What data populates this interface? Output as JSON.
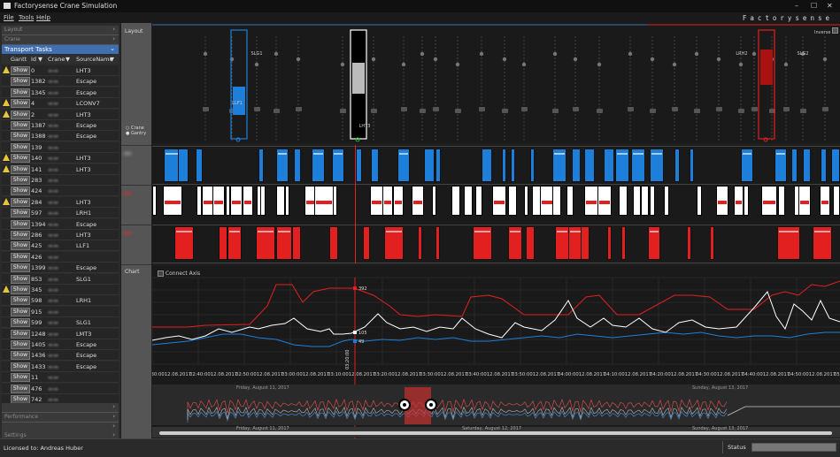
{
  "window": {
    "title": "Factorysense Crane Simulation",
    "brand": "Factorysense"
  },
  "menu": [
    "File",
    "Tools",
    "Help"
  ],
  "left_panel": {
    "collapsed_top": [
      "Layout",
      "Crane"
    ],
    "transport_tasks_label": "Transport Tasks",
    "columns": [
      "Gantt",
      "Id",
      "Crane",
      "SourceName"
    ],
    "show_label": "Show",
    "rows": [
      {
        "warn": true,
        "id": "0",
        "src": "LHT3"
      },
      {
        "warn": false,
        "id": "1382",
        "src": "Escape"
      },
      {
        "warn": false,
        "id": "1345",
        "src": "Escape"
      },
      {
        "warn": true,
        "id": "4",
        "src": "LCONV7"
      },
      {
        "warn": true,
        "id": "2",
        "src": "LHT3"
      },
      {
        "warn": false,
        "id": "1387",
        "src": "Escape"
      },
      {
        "warn": false,
        "id": "1388",
        "src": "Escape"
      },
      {
        "warn": false,
        "id": "139",
        "src": ""
      },
      {
        "warn": true,
        "id": "140",
        "src": "LHT3"
      },
      {
        "warn": true,
        "id": "141",
        "src": "LHT3"
      },
      {
        "warn": false,
        "id": "283",
        "src": ""
      },
      {
        "warn": false,
        "id": "424",
        "src": ""
      },
      {
        "warn": true,
        "id": "284",
        "src": "LHT3"
      },
      {
        "warn": false,
        "id": "597",
        "src": "LRH1"
      },
      {
        "warn": false,
        "id": "1394",
        "src": "Escape"
      },
      {
        "warn": false,
        "id": "286",
        "src": "LHT3"
      },
      {
        "warn": false,
        "id": "425",
        "src": "LLF1"
      },
      {
        "warn": false,
        "id": "426",
        "src": ""
      },
      {
        "warn": false,
        "id": "1399",
        "src": "Escape"
      },
      {
        "warn": false,
        "id": "853",
        "src": "SLG1"
      },
      {
        "warn": true,
        "id": "345",
        "src": ""
      },
      {
        "warn": false,
        "id": "598",
        "src": "LRH1"
      },
      {
        "warn": false,
        "id": "915",
        "src": ""
      },
      {
        "warn": false,
        "id": "599",
        "src": "SLG1"
      },
      {
        "warn": false,
        "id": "1248",
        "src": "LMT3"
      },
      {
        "warn": false,
        "id": "1405",
        "src": "Escape"
      },
      {
        "warn": false,
        "id": "1436",
        "src": "Escape"
      },
      {
        "warn": false,
        "id": "1433",
        "src": "Escape"
      },
      {
        "warn": false,
        "id": "11",
        "src": ""
      },
      {
        "warn": false,
        "id": "476",
        "src": ""
      },
      {
        "warn": false,
        "id": "742",
        "src": ""
      }
    ],
    "collapsed_bottom": [
      "",
      "Performance",
      "",
      "Settings"
    ]
  },
  "sidebar": {
    "layout": "Layout",
    "chart": "Chart"
  },
  "layout": {
    "legend": [
      "Crane",
      "Gantry"
    ],
    "inverse_label": "Inverse",
    "labels": [
      "SLG1",
      "LHT3",
      "LLF1",
      "LRH2",
      "SLG2"
    ]
  },
  "chart": {
    "connect_axis_label": "Connect Axis",
    "marker_labels": [
      "392",
      "105",
      "49"
    ],
    "cursor_time": "03:20:00",
    "time_labels": [
      "02:30:00",
      "02:40:00",
      "02:50:00",
      "03:00:00",
      "03:10:00",
      "03:20:00",
      "03:30:00",
      "03:40:00",
      "03:50:00",
      "04:00:00",
      "04:10:00",
      "04:20:00",
      "04:30:00",
      "04:40:00",
      "04:50:00",
      "05:00:00"
    ],
    "date_suffix": "12.08.2017",
    "overview_top_labels": [
      "Friday, August 11, 2017",
      "Sunday, August 13, 2017"
    ],
    "overview_bottom_labels": [
      "Friday, August 11, 2017",
      "Saturday, August 12, 2017",
      "Sunday, August 13, 2017"
    ]
  },
  "status": {
    "license": "Licensed to: Andreas Huber",
    "status_label": "Status"
  },
  "colors": {
    "blue": "#1e7fdb",
    "red": "#e32020",
    "white": "#ffffff",
    "accent": "#3f6fb1"
  }
}
